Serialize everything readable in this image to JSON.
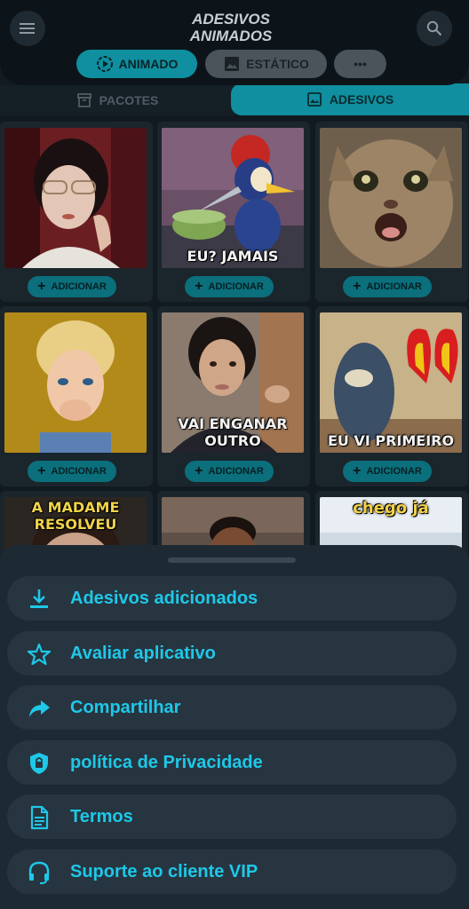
{
  "app": {
    "title_line1": "ADESIVOS",
    "title_line2": "ANIMADOS"
  },
  "modes": {
    "animado": "ANIMADO",
    "estatico": "ESTÁTICO",
    "more": "•••"
  },
  "tabs": {
    "pacotes": "PACOTES",
    "adesivos": "ADESIVOS"
  },
  "stickers": [
    {
      "caption": "",
      "button": "ADICIONAR"
    },
    {
      "caption": "EU? JAMAIS",
      "button": "ADICIONAR"
    },
    {
      "caption": "",
      "button": "ADICIONAR"
    },
    {
      "caption": "",
      "button": "ADICIONAR"
    },
    {
      "caption": "VAI ENGANAR OUTRO",
      "button": "ADICIONAR"
    },
    {
      "caption": "EU VI PRIMEIRO",
      "button": "ADICIONAR"
    },
    {
      "caption": "A MADAME RESOLVEU",
      "button": ""
    },
    {
      "caption": "",
      "button": ""
    },
    {
      "caption": "chego já",
      "button": ""
    }
  ],
  "menu": {
    "items": [
      {
        "label": "Adesivos adicionados",
        "icon": "download-icon"
      },
      {
        "label": "Avaliar aplicativo",
        "icon": "star-icon"
      },
      {
        "label": "Compartilhar",
        "icon": "share-icon"
      },
      {
        "label": "política de Privacidade",
        "icon": "shield-lock-icon"
      },
      {
        "label": "Termos",
        "icon": "document-icon"
      },
      {
        "label": "Suporte ao cliente VIP",
        "icon": "headset-icon"
      }
    ]
  },
  "colors": {
    "accent": "#1ec8e8",
    "teal": "#0f8f9f",
    "sheet": "#1e2a33"
  }
}
